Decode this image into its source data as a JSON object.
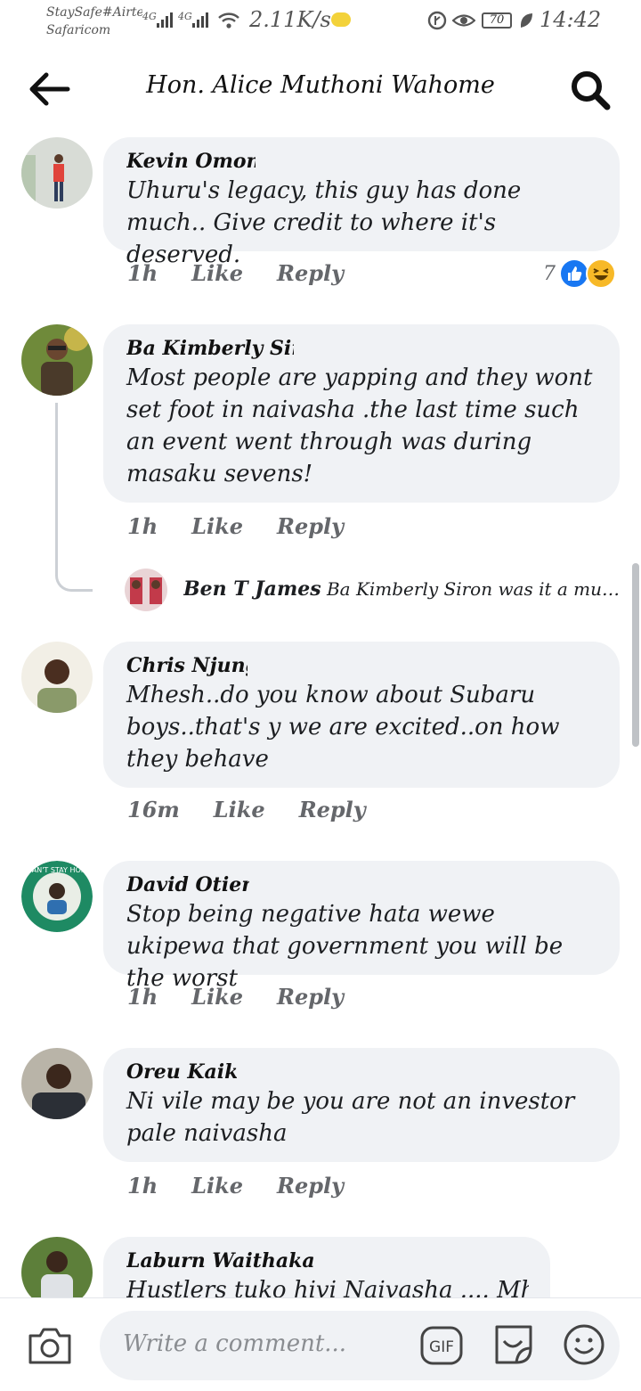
{
  "status_bar": {
    "carrier_line1": "StaySafe#Airtel",
    "carrier_line2": "Safaricom",
    "net1": "4G",
    "net2": "4G",
    "speed": "2.11K/s",
    "battery": "70",
    "time": "14:42"
  },
  "header": {
    "title": "Hon. Alice Muthoni Wahome",
    "back_icon": "arrow-left-icon",
    "search_icon": "search-icon"
  },
  "comments": [
    {
      "name": "Kevin Omondi",
      "text": "Uhuru's legacy, this guy has done much.. Give credit to where it's deserved.",
      "time": "1h",
      "like": "Like",
      "reply": "Reply",
      "reaction_count": "7"
    },
    {
      "name": "Ba Kimberly Siron",
      "text": "Most people are yapping and they wont set foot in naivasha .the last time such an event went through was during masaku sevens!",
      "time": "1h",
      "like": "Like",
      "reply": "Reply"
    },
    {
      "name": "Chris Njunge",
      "text": "Mhesh..do you know about Subaru boys..that's y we are excited..on how they behave",
      "time": "16m",
      "like": "Like",
      "reply": "Reply"
    },
    {
      "name": "David Otieno",
      "text": "Stop being negative hata wewe ukipewa that government you will be the worst",
      "time": "1h",
      "like": "Like",
      "reply": "Reply",
      "avatar_badge": "I CAN'T STAY HOME"
    },
    {
      "name": "Oreu Kaikai",
      "text": "Ni vile may be you are not an  investor pale naivasha",
      "time": "1h",
      "like": "Like",
      "reply": "Reply"
    },
    {
      "name": "Laburn Waithaka",
      "text": "Hustlers tuko hivi Naivasha .... Mhesh"
    }
  ],
  "reply_preview": {
    "name": "Ben T James",
    "text": "Ba Kimberly Siron was it a must ev..."
  },
  "composer": {
    "placeholder": "Write a comment...",
    "gif_label": "GIF"
  },
  "colors": {
    "bubble": "#f0f2f5",
    "like_blue": "#1877f2",
    "haha_yellow": "#f7b928",
    "meta_gray": "#65676b"
  }
}
